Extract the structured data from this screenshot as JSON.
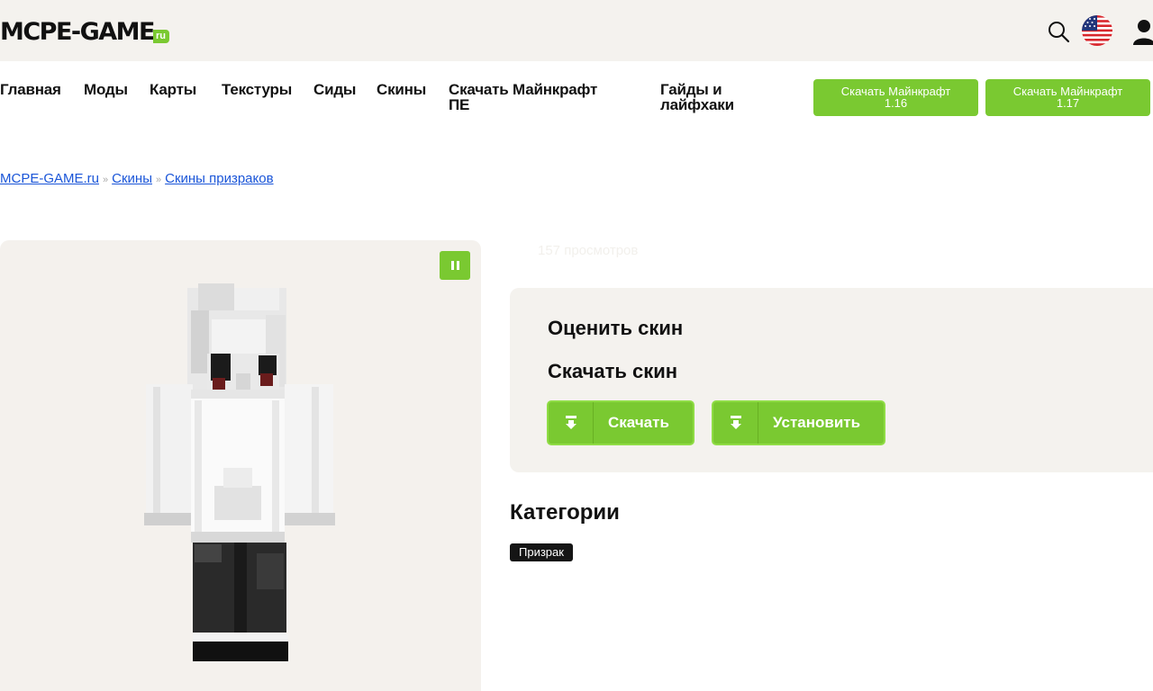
{
  "header": {
    "logo_main": "MCPE-GAME",
    "logo_suffix": "ru"
  },
  "nav": {
    "items": [
      "Главная",
      "Моды",
      "Карты",
      "Текстуры",
      "Сиды",
      "Скины"
    ],
    "download_pe": [
      "Скачать Майнкрафт",
      "ПЕ"
    ],
    "guides": [
      "Гайды и",
      "лайфхаки"
    ],
    "buttons": [
      {
        "line1": "Скачать Майнкрафт",
        "line2": "1.16"
      },
      {
        "line1": "Скачать Майнкрафт",
        "line2": "1.17"
      }
    ]
  },
  "breadcrumb": [
    "MCPE-GAME.ru",
    "Скины",
    "Скины призраков"
  ],
  "breadcrumb_sep": "»",
  "views": "157 просмотров",
  "card": {
    "rate_title": "Оценить скин",
    "download_title": "Скачать скин",
    "download_label": "Скачать",
    "install_label": "Установить"
  },
  "categories": {
    "title": "Категории",
    "tags": [
      "Призрак"
    ]
  },
  "colors": {
    "accent": "#7ac931",
    "link": "#1a55d8",
    "panel": "#f4f2ee",
    "tag_bg": "#151515"
  },
  "icons": [
    "search-icon",
    "us-flag-icon",
    "user-icon",
    "pause-icon",
    "download-icon"
  ]
}
